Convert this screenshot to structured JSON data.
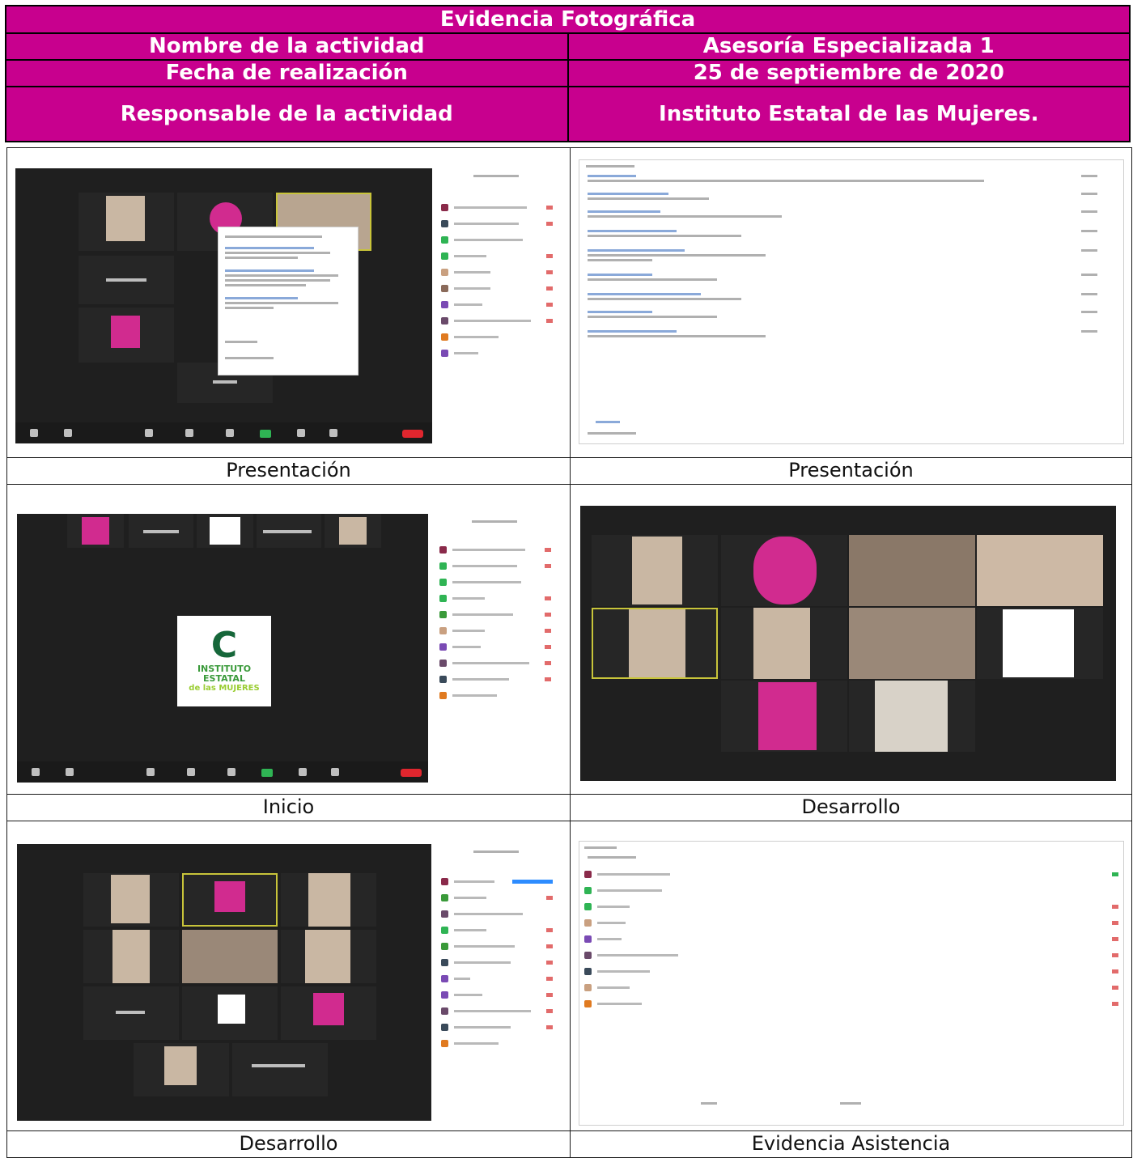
{
  "header": {
    "title": "Evidencia Fotográfica",
    "rows": [
      {
        "label": "Nombre de la actividad",
        "value": "Asesoría Especializada 1"
      },
      {
        "label": "Fecha de realización",
        "value": "25 de septiembre de 2020"
      },
      {
        "label": "Responsable de la actividad",
        "value": "Instituto Estatal de las Mujeres."
      }
    ]
  },
  "photos": [
    {
      "caption": "Presentación",
      "kind": "zoom meeting with chat"
    },
    {
      "caption": "Presentación",
      "kind": "zoom chat window"
    },
    {
      "caption": "Inicio",
      "kind": "zoom shared logo"
    },
    {
      "caption": "Desarrollo",
      "kind": "zoom gallery view"
    },
    {
      "caption": "Desarrollo",
      "kind": "zoom gallery with participants"
    },
    {
      "caption": "Evidencia Asistencia",
      "kind": "participants list"
    }
  ],
  "logo": {
    "line1": "INSTITUTO ESTATAL",
    "line2": "de las MUJERES"
  }
}
